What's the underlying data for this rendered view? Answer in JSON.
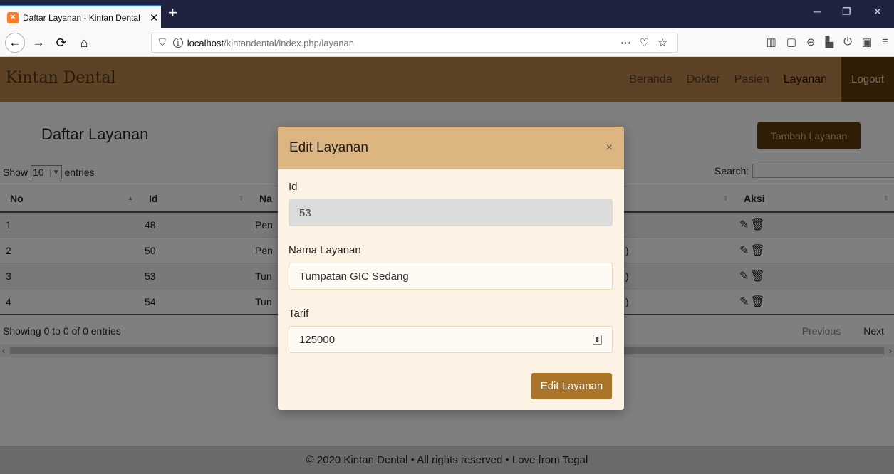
{
  "browser": {
    "tab_title": "Daftar Layanan - Kintan Dental",
    "tab_favicon": "XAMPP",
    "tab_close": "✕",
    "new_tab": "+",
    "url_host": "localhost",
    "url_path": "/kintandental/index.php/layanan",
    "url_actions": "⋯ ♡ ☆",
    "win_min": "─",
    "win_max": "❐",
    "win_close": "✕"
  },
  "header": {
    "brand": "Kintan Dental",
    "nav": [
      "Beranda",
      "Dokter",
      "Pasien",
      "Layanan",
      "Logout"
    ]
  },
  "main": {
    "title": "Daftar Layanan",
    "add_button": "Tambah Layanan",
    "show_label": "Show",
    "show_value": "10",
    "entries_label": "entries",
    "search_label": "Search:",
    "columns": [
      "No",
      "Id",
      "Na",
      "Aksi"
    ],
    "rows": [
      {
        "no": "1",
        "id": "48",
        "name": "Pen",
        "tarif": ""
      },
      {
        "no": "2",
        "id": "50",
        "name": "Pen",
        "tarif": ")"
      },
      {
        "no": "3",
        "id": "53",
        "name": "Tun",
        "tarif": ")"
      },
      {
        "no": "4",
        "id": "54",
        "name": "Tun",
        "tarif": ")"
      }
    ],
    "showing": "Showing 0 to 0 of 0 entries",
    "previous": "Previous",
    "next": "Next"
  },
  "footer": {
    "text": "© 2020 Kintan Dental • All rights reserved • Love from Tegal"
  },
  "modal": {
    "title": "Edit Layanan",
    "close": "×",
    "id_label": "Id",
    "id_value": "53",
    "nama_label": "Nama Layanan",
    "nama_value": "Tumpatan GIC Sedang",
    "tarif_label": "Tarif",
    "tarif_value": "125000",
    "submit": "Edit Layanan"
  },
  "colors": {
    "header": "#b8864b",
    "accent_dark": "#5e3d0a",
    "modal_header": "#dcb581",
    "modal_submit": "#ab7529"
  }
}
